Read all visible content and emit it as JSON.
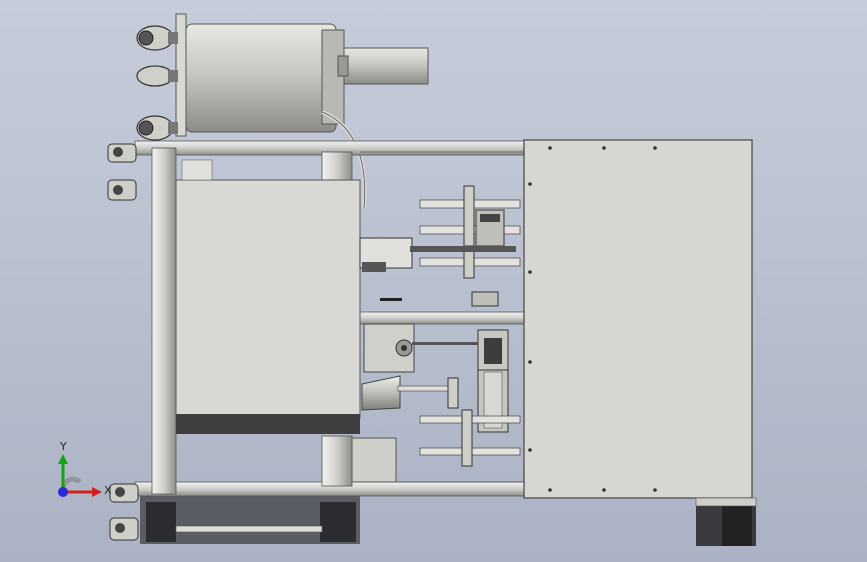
{
  "scene": {
    "description_type": "CAD top view assembly",
    "colors": {
      "background": "#b9c0cf",
      "frame": "#e6e6e4",
      "frame_shadow": "#7d7f82",
      "panel": "#d7d7d3",
      "dark": "#3b3b3b",
      "motor": "#c9c9c4"
    }
  },
  "triad": {
    "x_label": "X",
    "y_label": "Y",
    "x_color": "#d42020",
    "y_color": "#19a019",
    "z_color": "#2a2ad8"
  }
}
